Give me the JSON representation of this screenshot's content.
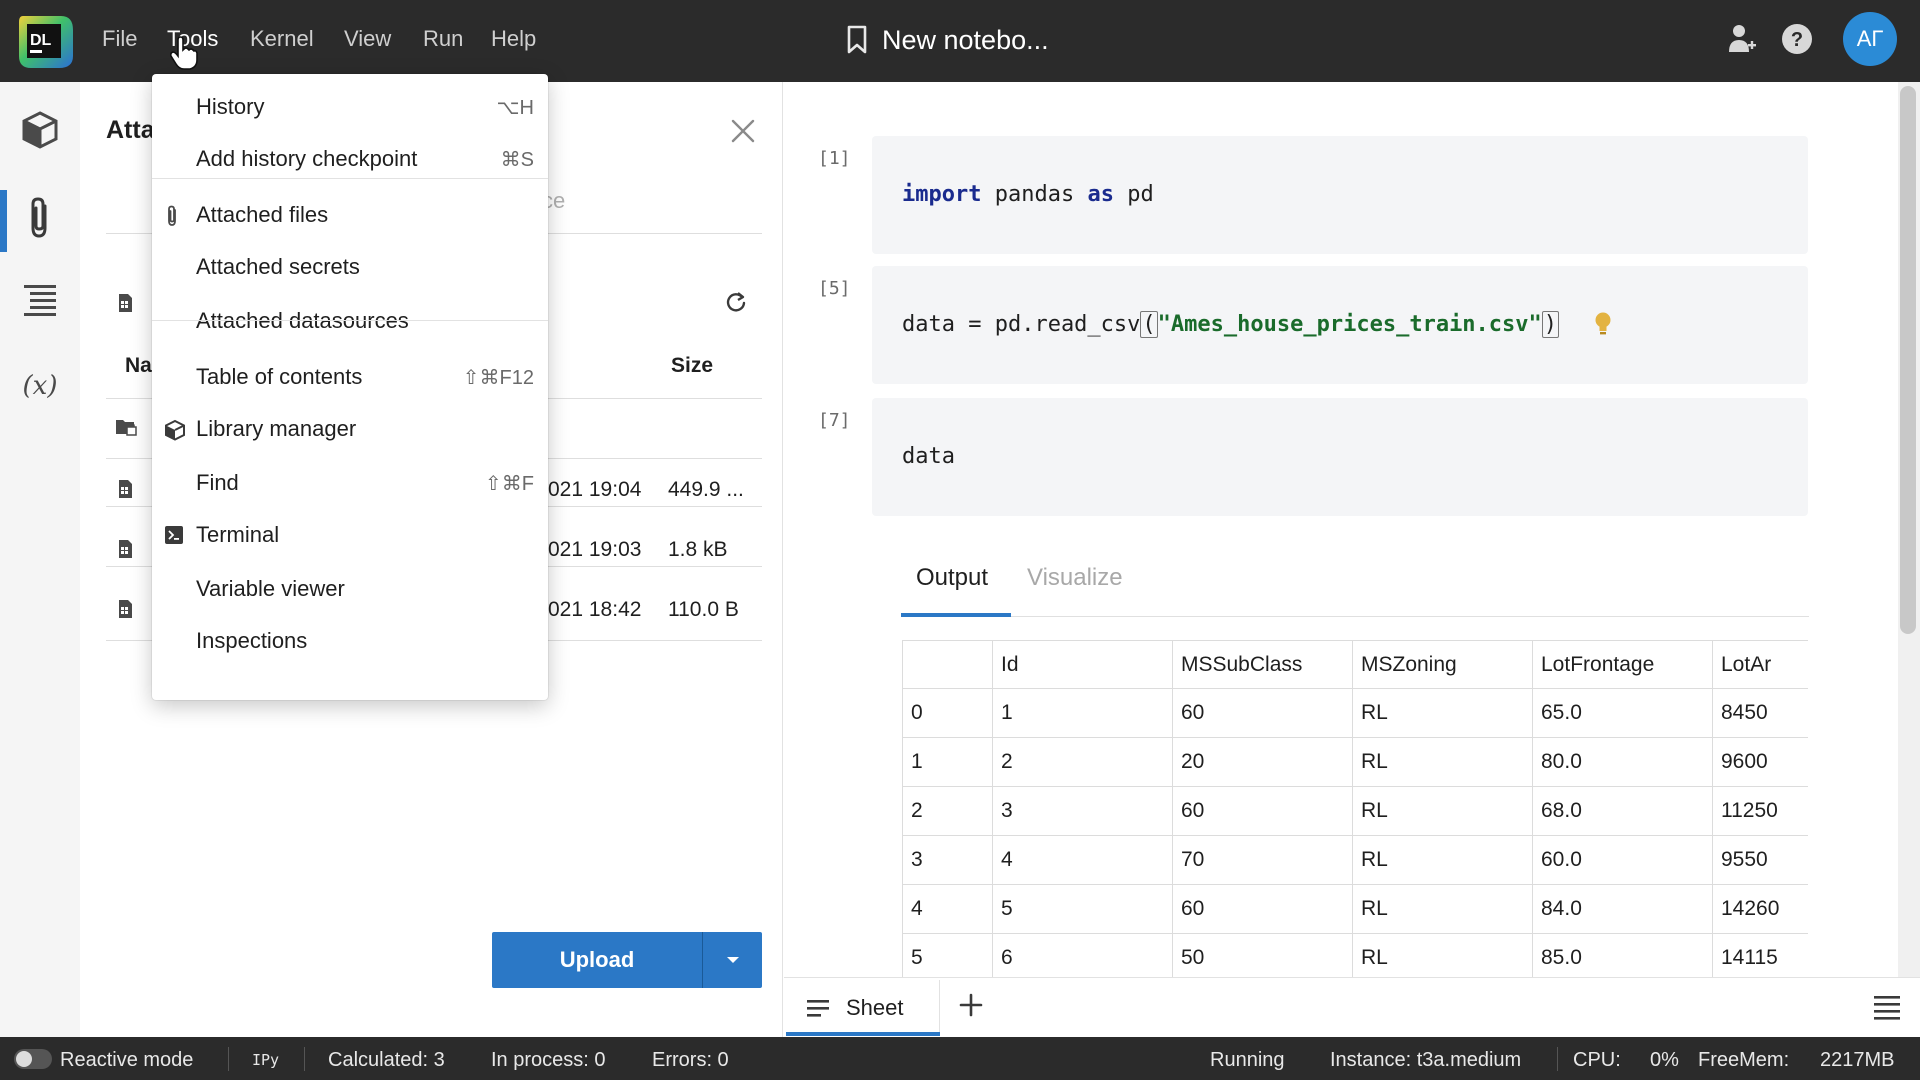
{
  "menu": {
    "items": [
      "File",
      "Tools",
      "Kernel",
      "View",
      "Run",
      "Help"
    ],
    "active": "Tools"
  },
  "header": {
    "title": "New notebo...",
    "avatar_initials": "АГ"
  },
  "tools_menu": {
    "groups": [
      [
        {
          "label": "History",
          "shortcut": "⌥H"
        },
        {
          "label": "Add history checkpoint",
          "shortcut": "⌘S"
        }
      ],
      [
        {
          "label": "Attached files",
          "shortcut": "",
          "icon": "paperclip-icon"
        },
        {
          "label": "Attached secrets",
          "shortcut": ""
        },
        {
          "label": "Attached datasources",
          "shortcut": ""
        }
      ],
      [
        {
          "label": "Table of contents",
          "shortcut": "⇧⌘F12"
        },
        {
          "label": "Library manager",
          "shortcut": "",
          "icon": "package-icon"
        },
        {
          "label": "Find",
          "shortcut": "⇧⌘F"
        },
        {
          "label": "Terminal",
          "shortcut": "",
          "icon": "terminal-icon"
        },
        {
          "label": "Variable viewer",
          "shortcut": ""
        },
        {
          "label": "Inspections",
          "shortcut": ""
        }
      ]
    ]
  },
  "files_panel": {
    "title_visible": "Atta",
    "tab_ghost": "ce",
    "col_name_visible": "Na",
    "col_size": "Size",
    "rows": [
      {
        "date": "021 19:04",
        "size": "449.9 ..."
      },
      {
        "date": "021 19:03",
        "size": "1.8 kB"
      },
      {
        "date": "021 18:42",
        "size": "110.0 B"
      }
    ],
    "upload_label": "Upload"
  },
  "cells": [
    {
      "num": "[1]",
      "tokens": [
        {
          "t": "import",
          "k": "kw"
        },
        {
          "t": " pandas "
        },
        {
          "t": "as",
          "k": "kw"
        },
        {
          "t": " pd"
        }
      ]
    },
    {
      "num": "[5]",
      "tokens": [
        {
          "t": "data = pd.read_csv"
        },
        {
          "t": "(",
          "k": "paren"
        },
        {
          "t": "\"Ames_house_prices_train.csv\"",
          "k": "str"
        },
        {
          "t": ")",
          "k": "paren"
        }
      ]
    },
    {
      "num": "[7]",
      "tokens": [
        {
          "t": "data"
        }
      ]
    }
  ],
  "output": {
    "tabs": [
      "Output",
      "Visualize"
    ],
    "active_tab": "Output",
    "table": {
      "headers": [
        "",
        "Id",
        "MSSubClass",
        "MSZoning",
        "LotFrontage",
        "LotAr"
      ],
      "rows": [
        [
          "0",
          "1",
          "60",
          "RL",
          "65.0",
          "8450"
        ],
        [
          "1",
          "2",
          "20",
          "RL",
          "80.0",
          "9600"
        ],
        [
          "2",
          "3",
          "60",
          "RL",
          "68.0",
          "11250"
        ],
        [
          "3",
          "4",
          "70",
          "RL",
          "60.0",
          "9550"
        ],
        [
          "4",
          "5",
          "60",
          "RL",
          "84.0",
          "14260"
        ],
        [
          "5",
          "6",
          "50",
          "RL",
          "85.0",
          "14115"
        ]
      ]
    }
  },
  "sheet": {
    "tab_label": "Sheet"
  },
  "status": {
    "reactive_mode": "Reactive mode",
    "ipy": "IPy",
    "calculated": "Calculated: 3",
    "in_process": "In process: 0",
    "errors": "Errors: 0",
    "running": "Running",
    "instance": "Instance: t3a.medium",
    "cpu_label": "CPU:",
    "cpu_value": "0%",
    "freemem_label": "FreeMem:",
    "freemem_value": "2217MB"
  },
  "colors": {
    "accent": "#2b78c6",
    "topbar": "#2b2b2b",
    "keyword": "#1a2b8e",
    "string": "#1a6b2b",
    "hint_bulb": "#e3b341"
  }
}
